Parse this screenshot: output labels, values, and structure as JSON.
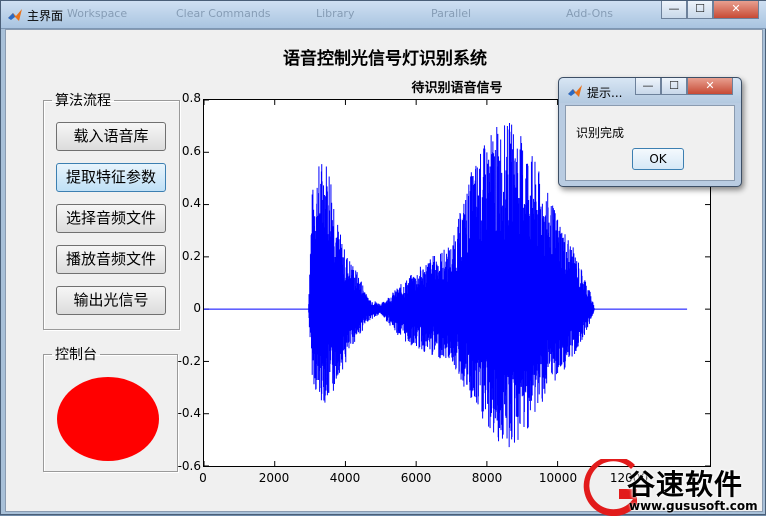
{
  "window": {
    "title": "主界面",
    "toolbar_ghost": [
      "Workspace",
      "Clear Commands",
      "Library",
      "Parallel",
      "Add-Ons"
    ],
    "minimize": "—",
    "maximize": "☐",
    "close": "✕"
  },
  "app": {
    "title": "语音控制光信号灯识别系统"
  },
  "flow_group": {
    "label": "算法流程",
    "buttons": [
      "载入语音库",
      "提取特征参数",
      "选择音频文件",
      "播放音频文件",
      "输出光信号"
    ]
  },
  "console_group": {
    "label": "控制台",
    "lamp_color": "#ff0000"
  },
  "chart_data": {
    "type": "line",
    "title": "待识别语音信号",
    "xlabel": "",
    "ylabel": "",
    "xlim": [
      0,
      7000
    ],
    "ylim": [
      -0.6,
      0.8
    ],
    "xticks": [
      0,
      2000,
      4000,
      6000,
      8000,
      10000,
      12000
    ],
    "yticks": [
      0.8,
      0.6,
      0.4,
      0.2,
      0,
      -0.2,
      -0.4,
      -0.6
    ],
    "series": [
      {
        "color": "#0000ff",
        "envelope": [
          {
            "x": 2950,
            "hi": 0.0,
            "lo": 0.0
          },
          {
            "x": 3050,
            "hi": 0.45,
            "lo": -0.25
          },
          {
            "x": 3200,
            "hi": 0.55,
            "lo": -0.35
          },
          {
            "x": 3400,
            "hi": 0.6,
            "lo": -0.36
          },
          {
            "x": 3600,
            "hi": 0.55,
            "lo": -0.36
          },
          {
            "x": 3800,
            "hi": 0.32,
            "lo": -0.25
          },
          {
            "x": 4000,
            "hi": 0.22,
            "lo": -0.22
          },
          {
            "x": 4200,
            "hi": 0.18,
            "lo": -0.14
          },
          {
            "x": 4500,
            "hi": 0.1,
            "lo": -0.08
          },
          {
            "x": 4800,
            "hi": 0.02,
            "lo": -0.02
          },
          {
            "x": 5100,
            "hi": 0.06,
            "lo": -0.06
          },
          {
            "x": 5400,
            "hi": 0.12,
            "lo": -0.15
          },
          {
            "x": 5700,
            "hi": 0.18,
            "lo": -0.18
          },
          {
            "x": 6000,
            "hi": 0.2,
            "lo": -0.2
          },
          {
            "x": 6200,
            "hi": 0.44,
            "lo": -0.28
          },
          {
            "x": 6400,
            "hi": 0.62,
            "lo": -0.42
          },
          {
            "x": 6600,
            "hi": 0.72,
            "lo": -0.52
          },
          {
            "x": 6800,
            "hi": 0.7,
            "lo": -0.55
          },
          {
            "x": 7000,
            "hi": 0.68,
            "lo": -0.48
          }
        ]
      }
    ]
  },
  "dialog": {
    "title": "提示...",
    "message": "识别完成",
    "ok": "OK"
  },
  "watermark": {
    "name": "谷速软件",
    "url": "www.gususoft.com"
  }
}
